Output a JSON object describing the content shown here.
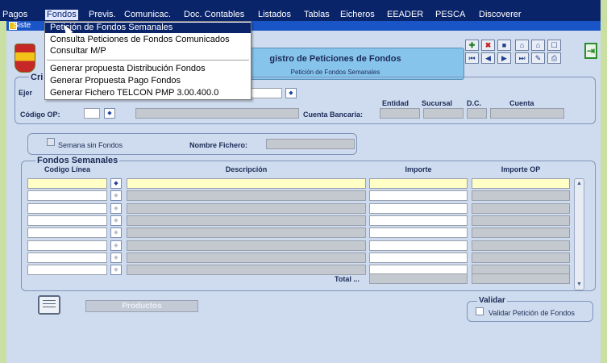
{
  "menubar": {
    "items": [
      {
        "label": "Pagos",
        "active": false
      },
      {
        "label": "Fondos",
        "active": true
      },
      {
        "label": "Previs.",
        "active": false
      },
      {
        "label": "Comunicac.",
        "active": false
      },
      {
        "label": "Doc. Contables",
        "active": false
      },
      {
        "label": "Listados",
        "active": false
      },
      {
        "label": "Tablas",
        "active": false
      },
      {
        "label": "Eicheros",
        "active": false
      },
      {
        "label": "EEADER",
        "active": false
      },
      {
        "label": "PESCA",
        "active": false
      },
      {
        "label": "Discoverer",
        "active": false
      }
    ]
  },
  "window": {
    "title_fragment": "Siste"
  },
  "dropdown": {
    "items": [
      {
        "label": "Petición de Fondos Semanales",
        "selected": true
      },
      {
        "label": "Consulta Peticiones de Fondos Comunicados",
        "selected": false
      },
      {
        "label": "Consultar M/P",
        "selected": false
      },
      {
        "label": "Generar propuesta Distribución Fondos",
        "selected": false
      },
      {
        "label": "Generar Propuesta Pago Fondos",
        "selected": false
      },
      {
        "label": "Generar Fichero TELCON PMP 3.00.400.0",
        "selected": false
      }
    ]
  },
  "header": {
    "title": "gistro de Peticiones de Fondos",
    "subtitle": "Petición de Fondos Semanales"
  },
  "criteria": {
    "title_fragment": "Cri",
    "ejercicio_fragment": "Ejer",
    "codigo_op_label": "Código OP:",
    "cuenta_bancaria_label": "Cuenta Bancaria:",
    "entidad_label": "Entidad",
    "sucursal_label": "Sucursal",
    "dc_label": "D.C.",
    "cuenta_label": "Cuenta"
  },
  "semana": {
    "semana_sin_fondos_label": "Semana sin Fondos",
    "nombre_fichero_label": "Nombre Fichero:"
  },
  "fondos": {
    "title": "Fondos Semanales",
    "columns": [
      "Codigo Línea",
      "Descripción",
      "Importe",
      "Importe OP"
    ],
    "total_label": "Total ..."
  },
  "buttons": {
    "productos": "Productos"
  },
  "validar": {
    "title": "Validar",
    "checkbox_label": "Validar Petición de Fondos"
  },
  "colors": {
    "menubar_bg": "#0a246a",
    "window_bg": "#cfdcef",
    "header_panel": "#86c4ec",
    "required_field": "#ffffc6",
    "outer_bg": "#c9dfa3"
  }
}
